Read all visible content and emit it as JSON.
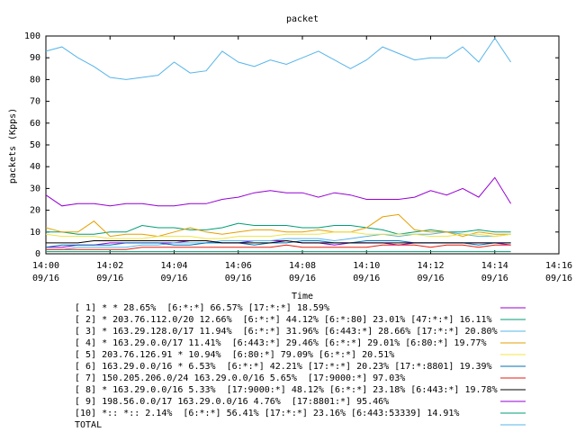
{
  "chart_data": {
    "type": "line",
    "title": "packet",
    "xlabel": "Time",
    "ylabel": "packets (Kpps)",
    "ylim": [
      0,
      100
    ],
    "yticks": [
      0,
      10,
      20,
      30,
      40,
      50,
      60,
      70,
      80,
      90,
      100
    ],
    "xlim": [
      "09/16 14:00",
      "09/16 14:16"
    ],
    "xticks": [
      {
        "time": "14:00",
        "date": "09/16"
      },
      {
        "time": "14:02",
        "date": "09/16"
      },
      {
        "time": "14:04",
        "date": "09/16"
      },
      {
        "time": "14:06",
        "date": "09/16"
      },
      {
        "time": "14:08",
        "date": "09/16"
      },
      {
        "time": "14:10",
        "date": "09/16"
      },
      {
        "time": "14:12",
        "date": "09/16"
      },
      {
        "time": "14:14",
        "date": "09/16"
      },
      {
        "time": "14:16",
        "date": "09/16"
      }
    ],
    "grid": false,
    "legend_position": "bottom",
    "x": [
      "14:00",
      "14:00:30",
      "14:01",
      "14:01:30",
      "14:02",
      "14:02:30",
      "14:03",
      "14:03:30",
      "14:04",
      "14:04:30",
      "14:05",
      "14:05:30",
      "14:06",
      "14:06:30",
      "14:07",
      "14:07:30",
      "14:08",
      "14:08:30",
      "14:09",
      "14:09:30",
      "14:10",
      "14:10:30",
      "14:11",
      "14:11:30",
      "14:12",
      "14:12:30",
      "14:13",
      "14:13:30",
      "14:14",
      "14:14:30"
    ],
    "series": [
      {
        "name": "[ 1] * * 28.65%  [6:*:*] 66.57% [17:*:*] 18.59%",
        "color": "#9400d3",
        "values": [
          3,
          3,
          4,
          4,
          5,
          5,
          5,
          5,
          5,
          6,
          6,
          5,
          5,
          6,
          6,
          6,
          5,
          5,
          4,
          5,
          5,
          5,
          4,
          5,
          5,
          5,
          5,
          5,
          5,
          4
        ]
      },
      {
        "name": "[ 2] * 203.76.112.0/20 12.66%  [6:*:*] 44.12% [6:*:80] 23.01% [47:*:*] 16.11%",
        "color": "#009e73",
        "values": [
          10,
          10,
          9,
          9,
          10,
          10,
          13,
          12,
          12,
          11,
          11,
          12,
          14,
          13,
          13,
          13,
          12,
          12,
          13,
          13,
          12,
          11,
          9,
          10,
          11,
          10,
          10,
          11,
          10,
          10
        ]
      },
      {
        "name": "[ 3] * 163.29.128.0/17 11.94%  [6:*:*] 31.96% [6:443:*] 28.66% [17:*:*] 20.80%",
        "color": "#56b4e9",
        "values": [
          2,
          2,
          3,
          3,
          3,
          3,
          4,
          4,
          5,
          5,
          5,
          6,
          6,
          6,
          6,
          7,
          7,
          7,
          6,
          7,
          8,
          9,
          8,
          9,
          9,
          10,
          9,
          8,
          8,
          9
        ]
      },
      {
        "name": "[ 4] * 163.29.0.0/17 11.41%  [6:443:*] 29.46% [6:*:*] 29.01% [6:80:*] 19.77%",
        "color": "#e69f00",
        "values": [
          12,
          10,
          10,
          15,
          8,
          9,
          9,
          8,
          10,
          12,
          10,
          9,
          10,
          11,
          11,
          10,
          10,
          11,
          10,
          10,
          12,
          17,
          18,
          11,
          10,
          10,
          8,
          10,
          9,
          9
        ]
      },
      {
        "name": "[ 5] 203.76.126.91 * 10.94%  [6:80:*] 79.09% [6:*:*] 20.51%",
        "color": "#f0e442",
        "values": [
          9,
          8,
          8,
          8,
          7,
          7,
          7,
          8,
          8,
          8,
          7,
          7,
          8,
          8,
          8,
          9,
          9,
          9,
          10,
          10,
          9,
          9,
          9,
          9,
          8,
          8,
          9,
          9,
          8,
          9
        ]
      },
      {
        "name": "[ 6] 163.29.0.0/16 * 6.53%  [6:*:*] 42.21% [17:*:*] 20.23% [17:*:8801] 19.39%",
        "color": "#0072b2",
        "values": [
          3,
          4,
          4,
          4,
          4,
          5,
          5,
          5,
          4,
          4,
          5,
          5,
          5,
          4,
          5,
          5,
          6,
          6,
          5,
          5,
          6,
          6,
          6,
          5,
          5,
          5,
          5,
          4,
          5,
          5
        ]
      },
      {
        "name": "[ 7] 150.205.206.0/24 163.29.0.0/16 5.65%  [17:9000:*] 97.03%",
        "color": "#e51e10",
        "values": [
          2,
          2,
          2,
          2,
          2,
          2,
          3,
          3,
          3,
          3,
          3,
          3,
          3,
          3,
          3,
          4,
          3,
          3,
          3,
          3,
          3,
          4,
          4,
          4,
          3,
          4,
          4,
          3,
          4,
          4
        ]
      },
      {
        "name": "[ 8] * 163.29.0.0/16 5.33%  [17:9000:*] 48.12% [6:*:*] 23.18% [6:443:*] 19.78%",
        "color": "#000000",
        "values": [
          5,
          5,
          5,
          6,
          6,
          6,
          6,
          6,
          6,
          6,
          6,
          5,
          5,
          5,
          5,
          6,
          5,
          5,
          5,
          5,
          5,
          5,
          5,
          5,
          5,
          5,
          5,
          5,
          5,
          5
        ]
      },
      {
        "name": "[ 9] 198.56.0.0/17 163.29.0.0/16 4.76%  [17:8801:*] 95.46%",
        "color": "#9400d3",
        "values": [
          27,
          22,
          23,
          23,
          22,
          23,
          23,
          22,
          22,
          23,
          23,
          25,
          26,
          28,
          29,
          28,
          28,
          26,
          28,
          27,
          25,
          25,
          25,
          26,
          29,
          27,
          30,
          26,
          35,
          23
        ]
      },
      {
        "name": "[10] *:: *:: 2.14%  [6:*:*] 56.41% [17:*:*] 23.16% [6:443:53339] 14.91%",
        "color": "#009e73",
        "values": [
          1,
          1,
          1,
          1,
          1,
          1,
          1,
          1,
          1,
          1,
          1,
          1,
          1,
          1,
          1,
          1,
          1,
          1,
          1,
          1,
          1,
          1,
          1,
          1,
          1,
          1,
          1,
          1,
          1,
          1
        ]
      },
      {
        "name": "TOTAL",
        "color": "#56b4e9",
        "values": [
          93,
          95,
          90,
          86,
          81,
          80,
          81,
          82,
          88,
          83,
          84,
          93,
          88,
          86,
          89,
          87,
          90,
          93,
          89,
          85,
          89,
          95,
          92,
          89,
          90,
          90,
          95,
          88,
          99,
          88
        ]
      }
    ]
  }
}
